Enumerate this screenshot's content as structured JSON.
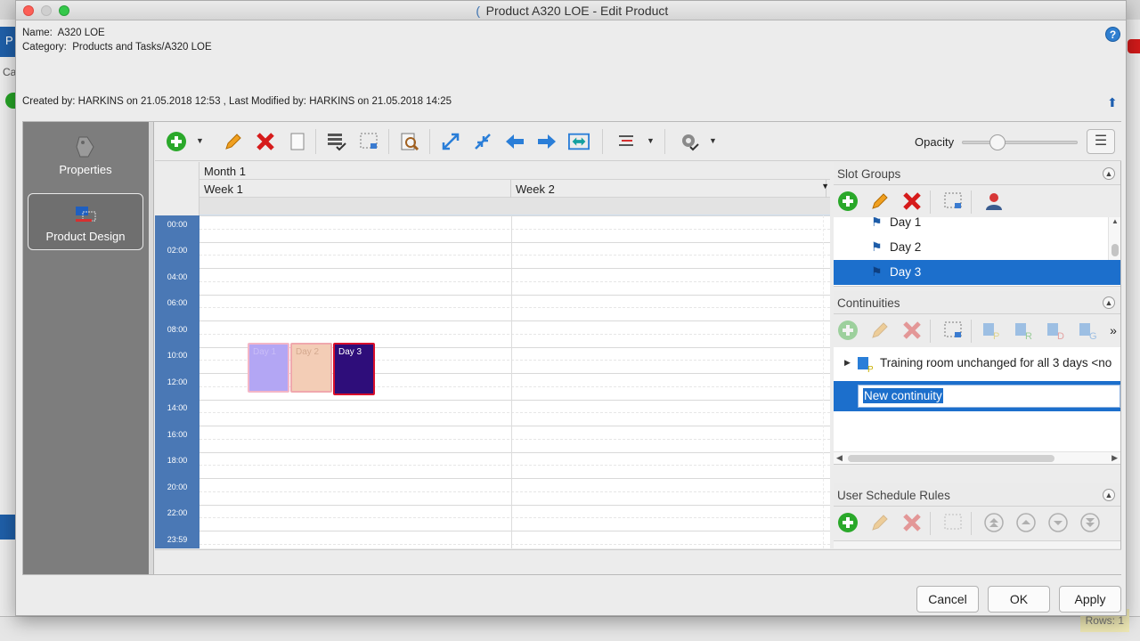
{
  "window": {
    "title": "Product A320 LOE - Edit Product"
  },
  "info": {
    "name_label": "Name:",
    "name_value": "A320 LOE",
    "category_label": "Category:",
    "category_value": "Products and Tasks/A320 LOE",
    "created_text": "Created by: HARKINS on 21.05.2018 12:53 ,  Last Modified by: HARKINS on 21.05.2018 14:25"
  },
  "nav": {
    "items": [
      {
        "label": "Properties",
        "icon": "tag-icon",
        "active": false
      },
      {
        "label": "Product Design",
        "icon": "product-design-icon",
        "active": true
      }
    ]
  },
  "toolbar": {
    "opacity_label": "Opacity",
    "opacity_value": 0.3
  },
  "calendar": {
    "month": "Month 1",
    "weeks": [
      "Week 1",
      "Week 2"
    ],
    "hours": [
      "00:00",
      "02:00",
      "04:00",
      "06:00",
      "08:00",
      "10:00",
      "12:00",
      "14:00",
      "16:00",
      "18:00",
      "20:00",
      "22:00",
      "23:59"
    ],
    "slots": [
      "Day 1",
      "Day 2",
      "Day 3"
    ]
  },
  "slot_groups": {
    "title": "Slot Groups",
    "items": [
      "Day 1",
      "Day 2",
      "Day 3"
    ],
    "selected": "Day 3"
  },
  "continuities": {
    "title": "Continuities",
    "tree_item": "Training room unchanged for all 3 days <no",
    "edit_value": "New continuity"
  },
  "user_schedule_rules": {
    "title": "User Schedule Rules"
  },
  "buttons": {
    "cancel": "Cancel",
    "ok": "OK",
    "apply": "Apply"
  },
  "background": {
    "left_tab": "P",
    "left_text": "Ca",
    "rows_text": "Rows: 1"
  },
  "colors": {
    "accent": "#1c6fcc",
    "hour_column": "#4a78b5",
    "nav_bg": "#7d7d7d",
    "day3_slot": "#2e0d7a"
  }
}
